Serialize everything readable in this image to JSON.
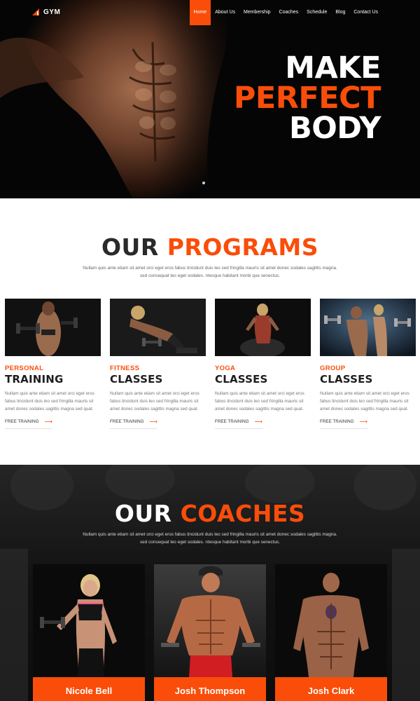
{
  "brand": {
    "logo_text": "GYM",
    "accent_color": "#fa4d09"
  },
  "nav": {
    "items": [
      {
        "label": "Home",
        "active": true
      },
      {
        "label": "About Us",
        "active": false
      },
      {
        "label": "Membership",
        "active": false
      },
      {
        "label": "Coaches",
        "active": false
      },
      {
        "label": "Schedule",
        "active": false
      },
      {
        "label": "Blog",
        "active": false
      },
      {
        "label": "Contact Us",
        "active": false
      }
    ]
  },
  "hero": {
    "line1": "MAKE",
    "line2": "PERFECT",
    "line3": "BODY"
  },
  "programs": {
    "title_part1": "OUR",
    "title_part2": "PROGRAMS",
    "description_line1": "Nullam quis ante etiam sit amet orci eget eros fabus tincidunt duis leo sed fringilla mauris sit amet donec sodales sagittis magna.",
    "description_line2": "sed consequat leo eget sodales. ntesque habitant morbi que senectus.",
    "cards": [
      {
        "kicker": "PERSONAL",
        "heading": "TRAINING",
        "text": "Nullam quis ante etiam sit amet orci eget eros fabus tincidunt duis leo sed fringilla mauris sit amet donec sodales sagittis magna sed quat.",
        "link": "FREE TRAINING",
        "image_icon": "athlete-with-dumbbells-photo"
      },
      {
        "kicker": "FITNESS",
        "heading": "CLASSES",
        "text": "Nullam quis ante etiam sit amet orci eget eros fabus tincidunt duis leo sed fringilla mauris sit amet donec sodales sagittis magna sed quat.",
        "link": "FREE TRAINING",
        "image_icon": "woman-lifting-dumbbell-photo"
      },
      {
        "kicker": "YOGA",
        "heading": "CLASSES",
        "text": "Nullam quis ante etiam sit amet orci eget eros fabus tincidunt duis leo sed fringilla mauris sit amet donec sodales sagittis magna sed quat.",
        "link": "FREE TRAINING",
        "image_icon": "woman-on-exercise-ball-photo"
      },
      {
        "kicker": "GROUP",
        "heading": "CLASSES",
        "text": "Nullam quis ante etiam sit amet orci eget eros fabus tincidunt duis leo sed fringilla mauris sit amet donec sodales sagittis magna sed quat.",
        "link": "FREE TRAINING",
        "image_icon": "couple-with-dumbbells-photo"
      }
    ]
  },
  "coaches": {
    "title_part1": "OUR",
    "title_part2": "COACHES",
    "description_line1": "Nullam quis ante etiam sit amet orci eget eros fabus tincidunt duis leo sed fringilla mauris sit amet donec sodales sagittis magna.",
    "description_line2": "sed consequat leo eget sodales. ntesque habitant morbi que senectus.",
    "cards": [
      {
        "name": "Nicole Bell",
        "image_icon": "female-coach-photo"
      },
      {
        "name": "Josh Thompson",
        "image_icon": "male-coach-cap-photo"
      },
      {
        "name": "Josh Clark",
        "image_icon": "male-coach-tattoo-photo"
      }
    ]
  }
}
